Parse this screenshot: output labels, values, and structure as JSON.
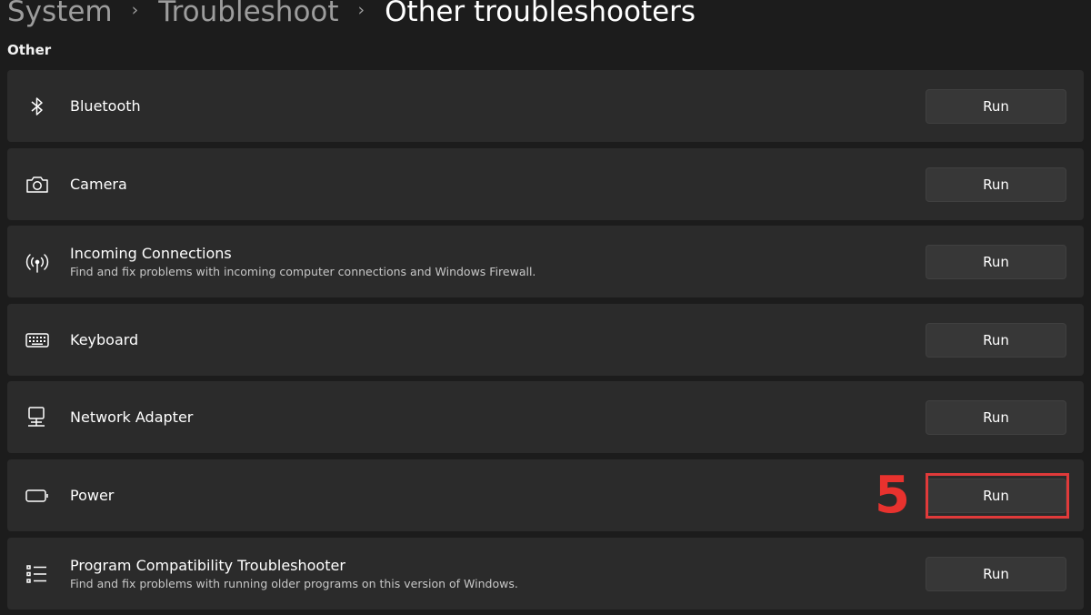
{
  "breadcrumb": {
    "items": [
      "System",
      "Troubleshoot",
      "Other troubleshooters"
    ],
    "separator": "›"
  },
  "section": {
    "title": "Other"
  },
  "troubleshooters": [
    {
      "icon": "bluetooth-icon",
      "title": "Bluetooth",
      "description": "",
      "button": "Run"
    },
    {
      "icon": "camera-icon",
      "title": "Camera",
      "description": "",
      "button": "Run"
    },
    {
      "icon": "antenna-icon",
      "title": "Incoming Connections",
      "description": "Find and fix problems with incoming computer connections and Windows Firewall.",
      "button": "Run"
    },
    {
      "icon": "keyboard-icon",
      "title": "Keyboard",
      "description": "",
      "button": "Run"
    },
    {
      "icon": "network-adapter-icon",
      "title": "Network Adapter",
      "description": "",
      "button": "Run"
    },
    {
      "icon": "battery-icon",
      "title": "Power",
      "description": "",
      "button": "Run"
    },
    {
      "icon": "list-icon",
      "title": "Program Compatibility Troubleshooter",
      "description": "Find and fix problems with running older programs on this version of Windows.",
      "button": "Run"
    }
  ],
  "annotation": {
    "step": "5",
    "color": "#e8322e"
  },
  "colors": {
    "background": "#1c1c1c",
    "card": "#2b2b2b",
    "button": "#373737",
    "breadcrumb_inactive": "#9d9d9d"
  }
}
